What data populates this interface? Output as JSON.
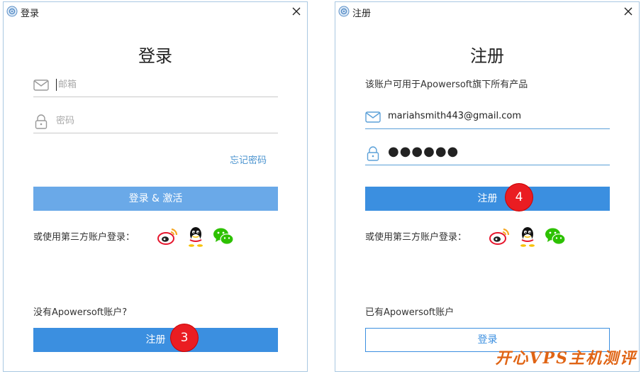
{
  "login": {
    "window_title": "登录",
    "heading": "登录",
    "email_placeholder": "邮箱",
    "password_placeholder": "密码",
    "forgot_password": "忘记密码",
    "login_button": "登录 & 激活",
    "third_party_label": "或使用第三方账户登录：",
    "no_account_text": "没有Apowersoft账户?",
    "register_button": "注册",
    "step_badge": "3"
  },
  "register": {
    "window_title": "注册",
    "heading": "注册",
    "description": "该账户可用于Apowersoft旗下所有产品",
    "email_value": "mariahsmith443@gmail.com",
    "password_masked": "●●●●●●",
    "register_button": "注册",
    "step_badge": "4",
    "third_party_label": "或使用第三方账户登录：",
    "have_account_text": "已有Apowersoft账户",
    "login_button": "登录"
  },
  "social_icons": [
    "weibo-icon",
    "qq-icon",
    "wechat-icon"
  ],
  "watermark": "开心VPS主机测评",
  "colors": {
    "primary": "#3b8fe0",
    "primary_light": "#6aa9e8",
    "link": "#4a93cf",
    "badge": "#ea1d22",
    "watermark": "#e06414"
  }
}
